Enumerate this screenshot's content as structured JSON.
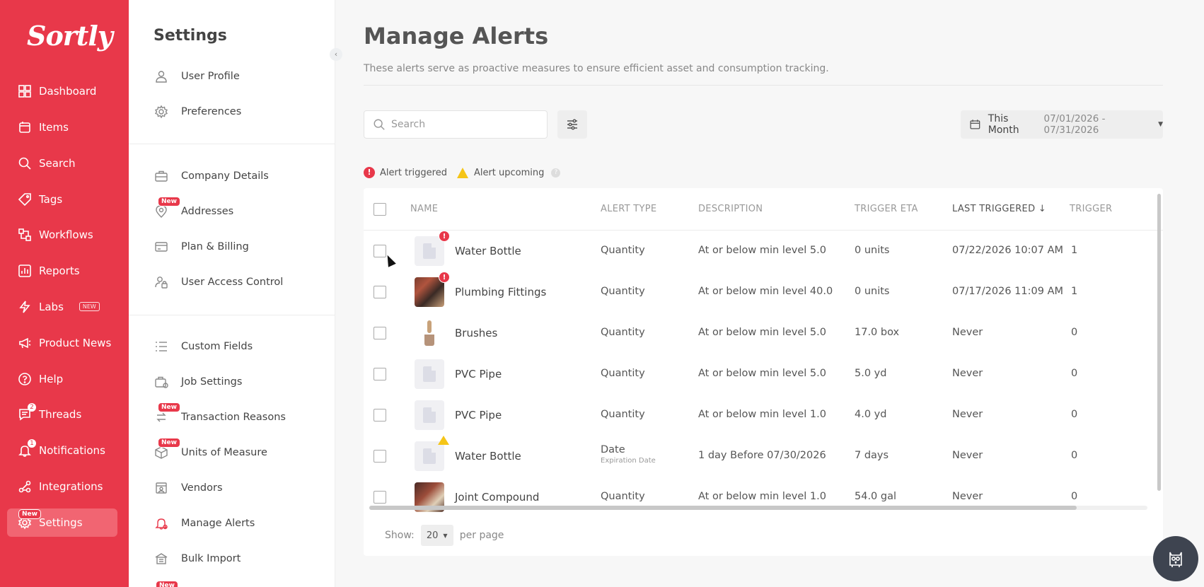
{
  "app": {
    "logo": "Sortly"
  },
  "nav": {
    "items": [
      {
        "label": "Dashboard",
        "icon": "dashboard-icon"
      },
      {
        "label": "Items",
        "icon": "items-icon"
      },
      {
        "label": "Search",
        "icon": "search-icon"
      },
      {
        "label": "Tags",
        "icon": "tag-icon"
      },
      {
        "label": "Workflows",
        "icon": "workflow-icon"
      },
      {
        "label": "Reports",
        "icon": "reports-icon"
      },
      {
        "label": "Labs",
        "icon": "lightning-icon",
        "badge": "NEW"
      },
      {
        "label": "Product News",
        "icon": "megaphone-icon"
      },
      {
        "label": "Help",
        "icon": "help-icon"
      },
      {
        "label": "Threads",
        "icon": "threads-icon",
        "count": "2"
      },
      {
        "label": "Notifications",
        "icon": "bell-icon",
        "count": "1"
      },
      {
        "label": "Integrations",
        "icon": "integrations-icon"
      },
      {
        "label": "Settings",
        "icon": "gear-icon",
        "new_tag": "New",
        "active": true
      }
    ]
  },
  "settings": {
    "title": "Settings",
    "groups": [
      [
        {
          "label": "User Profile",
          "icon": "user-icon"
        },
        {
          "label": "Preferences",
          "icon": "gear-icon"
        }
      ],
      [
        {
          "label": "Company Details",
          "icon": "briefcase-icon"
        },
        {
          "label": "Addresses",
          "icon": "location-icon",
          "new_tag": "New"
        },
        {
          "label": "Plan & Billing",
          "icon": "credit-card-icon"
        },
        {
          "label": "User Access Control",
          "icon": "user-lock-icon"
        }
      ],
      [
        {
          "label": "Custom Fields",
          "icon": "list-icon"
        },
        {
          "label": "Job Settings",
          "icon": "job-icon"
        },
        {
          "label": "Transaction Reasons",
          "icon": "transaction-icon",
          "new_tag": "New"
        },
        {
          "label": "Units of Measure",
          "icon": "box-icon",
          "new_tag": "New"
        },
        {
          "label": "Vendors",
          "icon": "vendor-icon"
        },
        {
          "label": "Manage Alerts",
          "icon": "bell-alert-icon",
          "active": true
        },
        {
          "label": "Bulk Import",
          "icon": "bulk-import-icon"
        }
      ]
    ],
    "trailing_new_tag": "New"
  },
  "main": {
    "title": "Manage Alerts",
    "subtitle": "These alerts serve as proactive measures to ensure efficient asset and consumption tracking.",
    "search": {
      "placeholder": "Search",
      "value": ""
    },
    "date_filter": {
      "label": "This Month",
      "range": "07/01/2026 - 07/31/2026"
    },
    "legend": {
      "triggered": "Alert triggered",
      "upcoming": "Alert upcoming",
      "triggered_glyph": "!"
    },
    "columns": [
      "NAME",
      "ALERT TYPE",
      "DESCRIPTION",
      "TRIGGER ETA",
      "LAST TRIGGERED",
      "TRIGGER"
    ],
    "sorted_column_arrow": "↓",
    "rows": [
      {
        "name": "Water Bottle",
        "alert_type": "Quantity",
        "alert_sub": "",
        "description": "At or below min level 5.0",
        "eta": "0 units",
        "last": "07/22/2026 10:07 AM",
        "count": "1",
        "status": "triggered",
        "thumb": "placeholder"
      },
      {
        "name": "Plumbing Fittings",
        "alert_type": "Quantity",
        "alert_sub": "",
        "description": "At or below min level 40.0",
        "eta": "0 units",
        "last": "07/17/2026 11:09 AM",
        "count": "1",
        "status": "triggered",
        "thumb": "photo-pf"
      },
      {
        "name": "Brushes",
        "alert_type": "Quantity",
        "alert_sub": "",
        "description": "At or below min level 5.0",
        "eta": "17.0 box",
        "last": "Never",
        "count": "0",
        "status": "none",
        "thumb": "photo-br"
      },
      {
        "name": "PVC Pipe",
        "alert_type": "Quantity",
        "alert_sub": "",
        "description": "At or below min level 5.0",
        "eta": "5.0 yd",
        "last": "Never",
        "count": "0",
        "status": "none",
        "thumb": "placeholder"
      },
      {
        "name": "PVC Pipe",
        "alert_type": "Quantity",
        "alert_sub": "",
        "description": "At or below min level 1.0",
        "eta": "4.0 yd",
        "last": "Never",
        "count": "0",
        "status": "none",
        "thumb": "placeholder"
      },
      {
        "name": "Water Bottle",
        "alert_type": "Date",
        "alert_sub": "Expiration Date",
        "description": "1 day Before 07/30/2026",
        "eta": "7 days",
        "last": "Never",
        "count": "0",
        "status": "upcoming",
        "thumb": "placeholder"
      },
      {
        "name": "Joint Compound",
        "alert_type": "Quantity",
        "alert_sub": "",
        "description": "At or below min level 1.0",
        "eta": "54.0 gal",
        "last": "Never",
        "count": "0",
        "status": "none",
        "thumb": "photo-jc"
      }
    ],
    "pagination": {
      "show_label": "Show:",
      "per_page_value": "20",
      "per_page_label": "per page"
    }
  },
  "colors": {
    "brand": "#e8384a",
    "warning": "#f5c518"
  }
}
